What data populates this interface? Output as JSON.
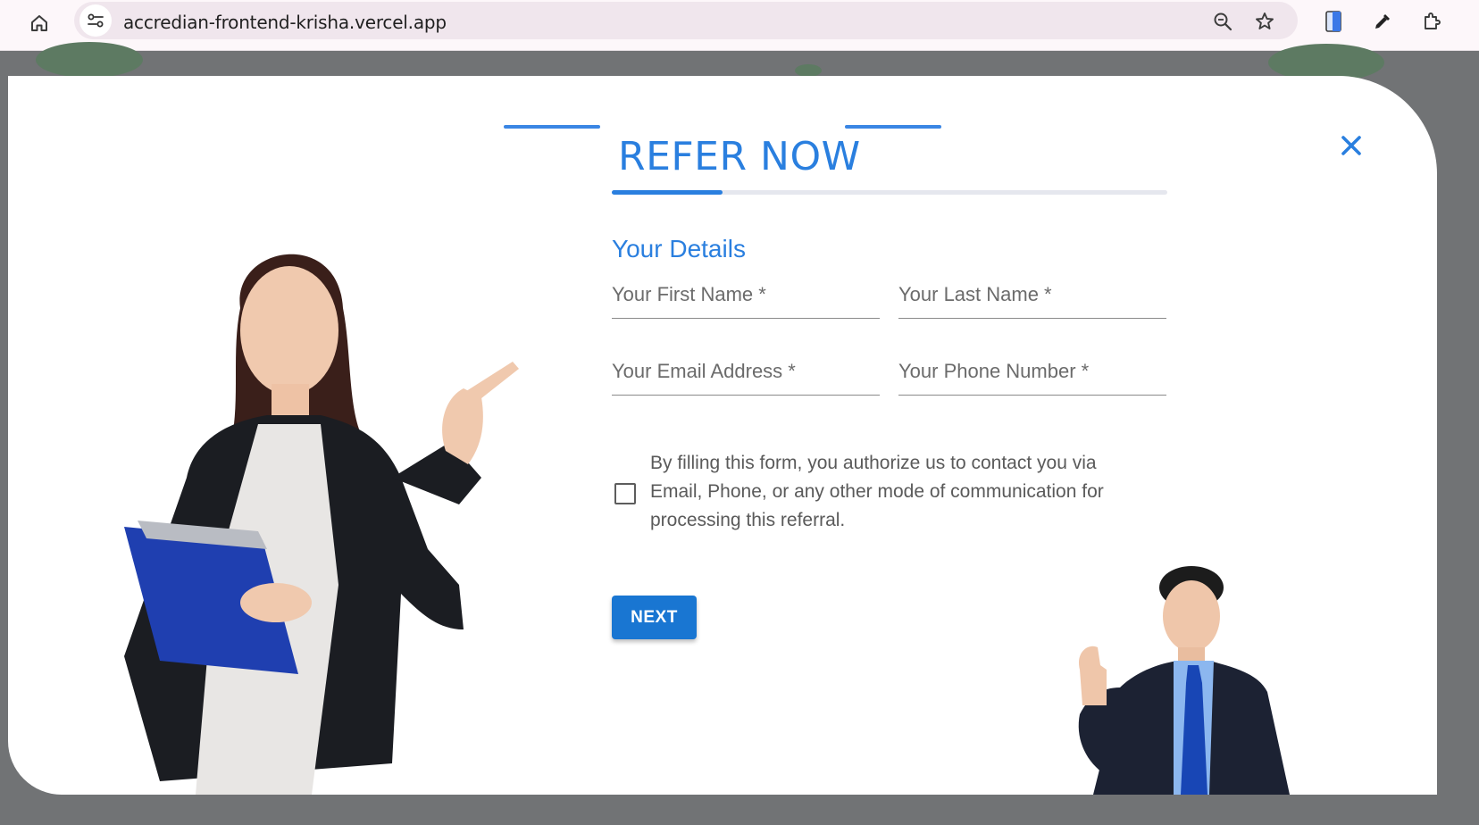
{
  "browser": {
    "url": "accredian-frontend-krisha.vercel.app",
    "icons": [
      "home-icon",
      "site-info-icon",
      "zoom-icon",
      "bookmark-star-icon",
      "reading-mode-icon",
      "eyedropper-icon",
      "extensions-icon"
    ]
  },
  "modal": {
    "title": "REFER NOW",
    "close_label": "✕",
    "progress": 0.2,
    "section_title": "Your Details",
    "fields": {
      "first_name": "Your First Name *",
      "last_name": "Your Last Name *",
      "email": "Your Email Address *",
      "phone": "Your Phone Number *"
    },
    "consent_text": "By filling this form, you authorize us to contact you via Email, Phone, or any other mode of communication for processing this referral.",
    "next_label": "NEXT"
  },
  "colors": {
    "accent": "#2a7fdf",
    "button": "#1976d2",
    "backdrop": "#717375"
  }
}
